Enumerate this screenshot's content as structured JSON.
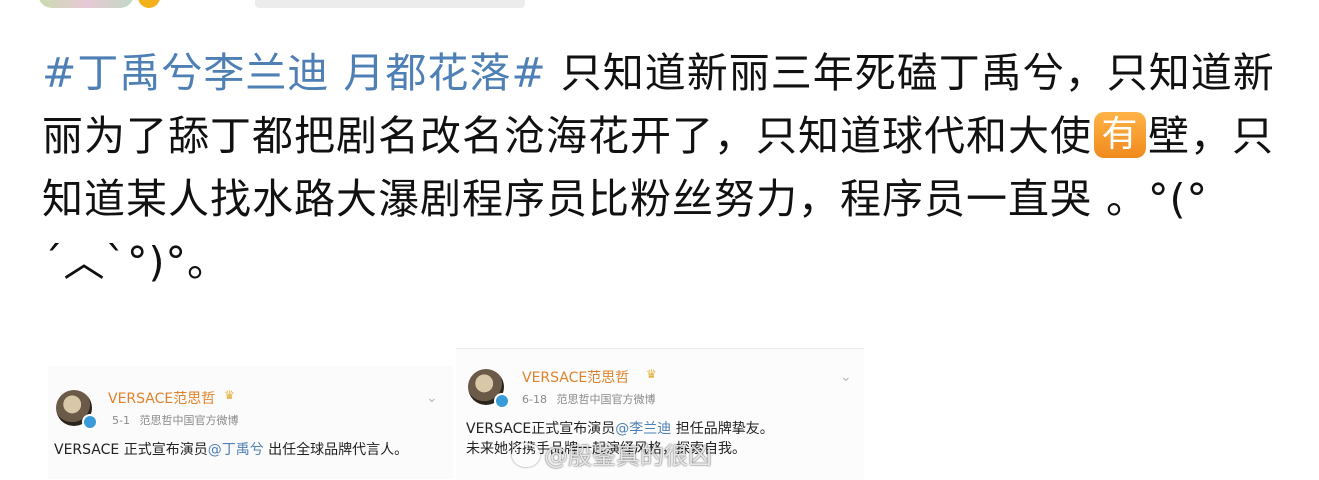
{
  "post": {
    "topic": "#丁禹兮李兰迪 月都花落#",
    "text_before_emoji": " 只知道新丽三年死磕丁禹兮，只知道新丽为了舔丁都把剧名改名沧海花开了，只知道球代和大使",
    "emoji_label": "有",
    "text_after_emoji": "壁，只知道某人找水路大瀑剧程序员比粉丝努力，程序员一直哭 。°(°´︿`°)°。"
  },
  "cards": [
    {
      "account": "VERSACE范思哲",
      "date": "5-1",
      "source": "范思哲中国官方微博",
      "body_prefix": "VERSACE 正式宣布演员",
      "mention": "@丁禹兮",
      "body_suffix": " 出任全球品牌代言人。"
    },
    {
      "account": "VERSACE范思哲",
      "date": "6-18",
      "source": "范思哲中国官方微博",
      "body_prefix": "VERSACE正式宣布演员",
      "mention": "@李兰迪",
      "body_suffix": " 担任品牌挚友。",
      "body_line2": "未来她将携手品牌一起演绎风格，探索自我。"
    }
  ],
  "watermark": "@殷鉴真的很凶",
  "icons": {
    "verified": "verified-badge-icon",
    "crown": "crown-icon",
    "more": "chevron-down-icon"
  },
  "colors": {
    "topic": "#4e7fb5",
    "account_name": "#e0822b",
    "emoji_bg": "#f08a1d"
  }
}
